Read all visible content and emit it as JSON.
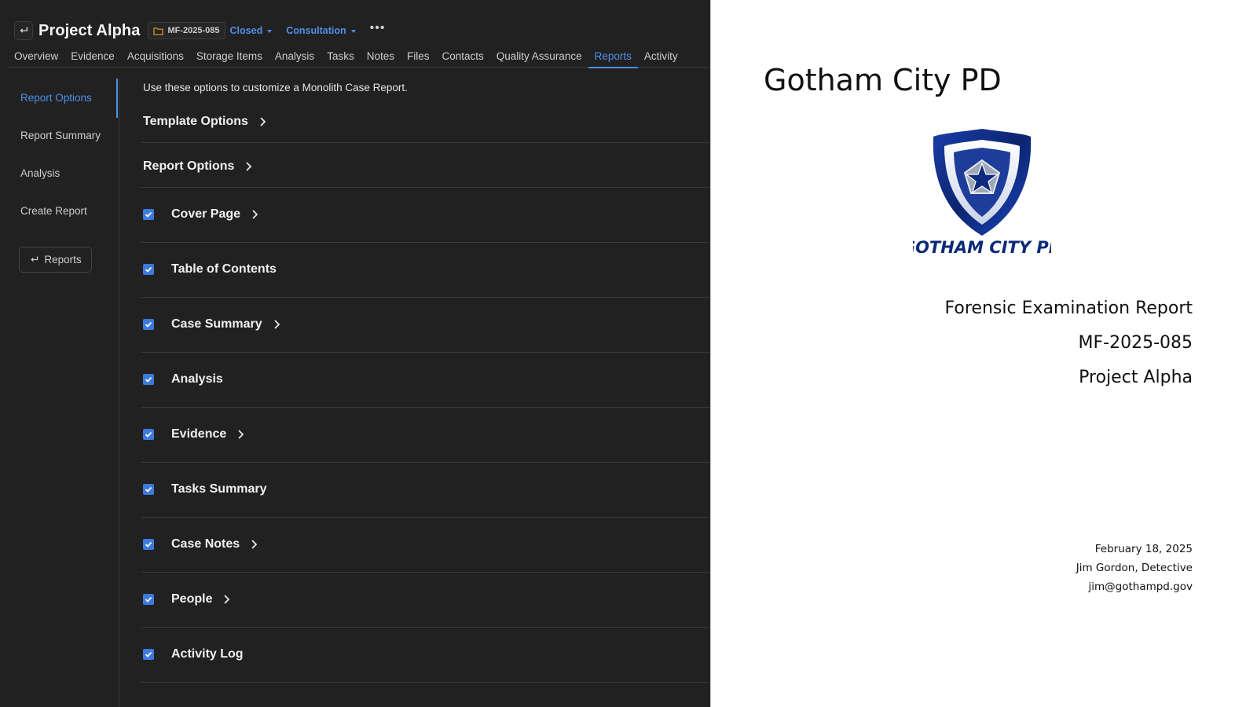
{
  "header": {
    "title": "Project Alpha",
    "case_number": "MF-2025-085",
    "status": "Closed",
    "type": "Consultation",
    "more_label": "•••"
  },
  "tabs": [
    {
      "label": "Overview"
    },
    {
      "label": "Evidence"
    },
    {
      "label": "Acquisitions"
    },
    {
      "label": "Storage Items"
    },
    {
      "label": "Analysis"
    },
    {
      "label": "Tasks"
    },
    {
      "label": "Notes"
    },
    {
      "label": "Files"
    },
    {
      "label": "Contacts"
    },
    {
      "label": "Quality Assurance"
    },
    {
      "label": "Reports"
    },
    {
      "label": "Activity"
    }
  ],
  "active_tab": "Reports",
  "sidebar": {
    "items": [
      {
        "label": "Report Options"
      },
      {
        "label": "Report Summary"
      },
      {
        "label": "Analysis"
      },
      {
        "label": "Create Report"
      }
    ],
    "back_button_label": "Reports"
  },
  "main": {
    "intro": "Use these options to customize a Monolith Case Report.",
    "groups": [
      {
        "label": "Template Options"
      },
      {
        "label": "Report Options"
      }
    ],
    "sections": [
      {
        "label": "Cover Page",
        "checked": true,
        "expandable": true
      },
      {
        "label": "Table of Contents",
        "checked": true,
        "expandable": false
      },
      {
        "label": "Case Summary",
        "checked": true,
        "expandable": true
      },
      {
        "label": "Analysis",
        "checked": true,
        "expandable": false
      },
      {
        "label": "Evidence",
        "checked": true,
        "expandable": true
      },
      {
        "label": "Tasks Summary",
        "checked": true,
        "expandable": false
      },
      {
        "label": "Case Notes",
        "checked": true,
        "expandable": true
      },
      {
        "label": "People",
        "checked": true,
        "expandable": true
      },
      {
        "label": "Activity Log",
        "checked": true,
        "expandable": false
      }
    ]
  },
  "preview": {
    "org_name": "Gotham City PD",
    "logo_text": "GOTHAM CITY PD",
    "report_title": "Forensic Examination Report",
    "case_number": "MF-2025-085",
    "case_name": "Project Alpha",
    "date": "February 18, 2025",
    "examiner": "Jim Gordon, Detective",
    "email": "jim@gothampd.gov"
  },
  "colors": {
    "accent": "#4f8fe8",
    "checkbox": "#3c7ae0",
    "background": "#212121",
    "logo_navy": "#0b2a78"
  }
}
